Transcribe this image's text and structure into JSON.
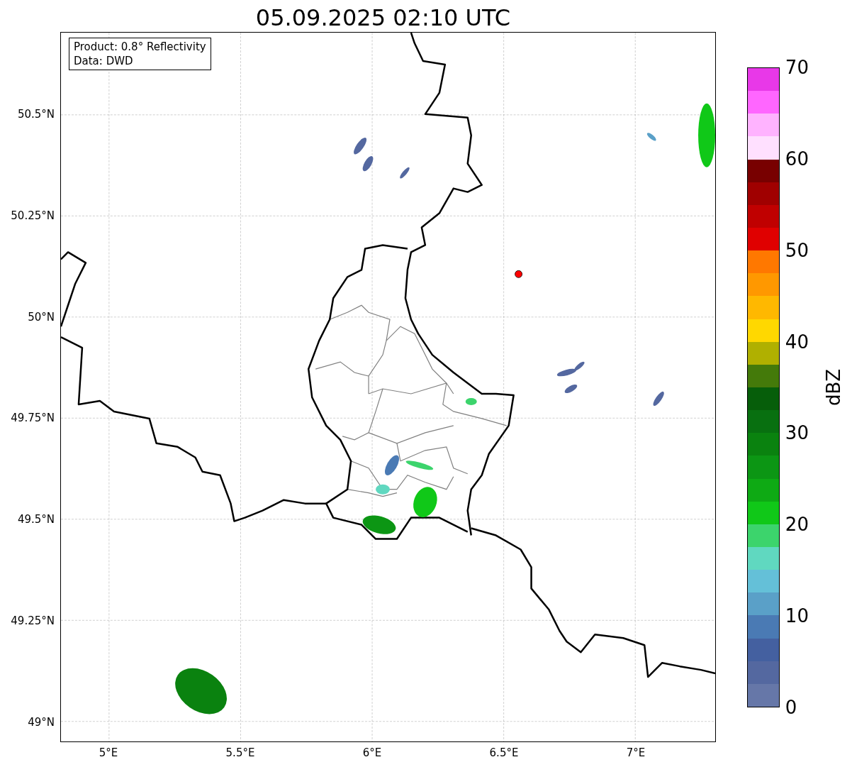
{
  "title": "05.09.2025 02:10 UTC",
  "annotation": {
    "lines": [
      "Product: 0.8° Reflectivity",
      "Data: DWD"
    ]
  },
  "map": {
    "xticks": [
      "5°E",
      "5.5°E",
      "6°E",
      "6.5°E",
      "7°E"
    ],
    "yticks": [
      "50.5°N",
      "50.25°N",
      "50°N",
      "49.75°N",
      "49.5°N",
      "49.25°N",
      "49°N"
    ]
  },
  "colorbar": {
    "label": "dBZ",
    "ticks": [
      "70",
      "60",
      "50",
      "40",
      "30",
      "20",
      "10",
      "0"
    ],
    "segments": [
      {
        "color": "#e838e8"
      },
      {
        "color": "#ff66ff"
      },
      {
        "color": "#ffb3ff"
      },
      {
        "color": "#ffe0ff"
      },
      {
        "color": "#780000"
      },
      {
        "color": "#a00000"
      },
      {
        "color": "#c00000"
      },
      {
        "color": "#e00000"
      },
      {
        "color": "#ff7800"
      },
      {
        "color": "#ff9800"
      },
      {
        "color": "#ffb800"
      },
      {
        "color": "#ffd800"
      },
      {
        "color": "#b0b000"
      },
      {
        "color": "#447a0a"
      },
      {
        "color": "#065e0a"
      },
      {
        "color": "#087010"
      },
      {
        "color": "#0a820f"
      },
      {
        "color": "#0c9614"
      },
      {
        "color": "#0eaa14"
      },
      {
        "color": "#10c818"
      },
      {
        "color": "#3cd46c"
      },
      {
        "color": "#60d8c0"
      },
      {
        "color": "#64c0d8"
      },
      {
        "color": "#5aa0c8"
      },
      {
        "color": "#4a7ab4"
      },
      {
        "color": "#4460a0"
      },
      {
        "color": "#5468a0"
      },
      {
        "color": "#6677a8"
      }
    ]
  }
}
